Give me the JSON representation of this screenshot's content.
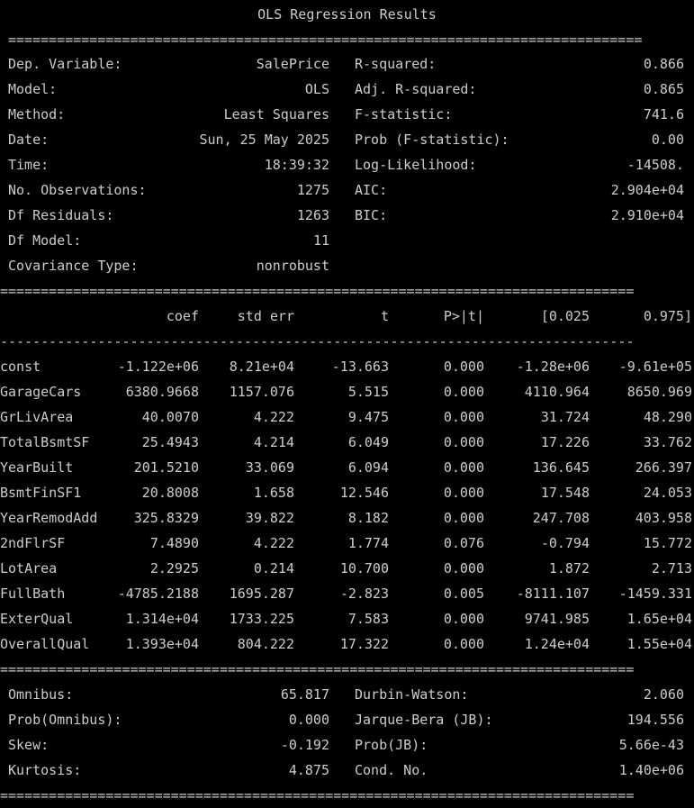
{
  "title": "OLS Regression Results",
  "rule_double": "==============================================================================",
  "rule_single": "------------------------------------------------------------------------------",
  "top_stats": [
    {
      "l_label": "Dep. Variable:",
      "l_value": "SalePrice",
      "r_label": "R-squared:",
      "r_value": "0.866"
    },
    {
      "l_label": "Model:",
      "l_value": "OLS",
      "r_label": "Adj. R-squared:",
      "r_value": "0.865"
    },
    {
      "l_label": "Method:",
      "l_value": "Least Squares",
      "r_label": "F-statistic:",
      "r_value": "741.6"
    },
    {
      "l_label": "Date:",
      "l_value": "Sun, 25 May 2025",
      "r_label": "Prob (F-statistic):",
      "r_value": "0.00"
    },
    {
      "l_label": "Time:",
      "l_value": "18:39:32",
      "r_label": "Log-Likelihood:",
      "r_value": "-14508."
    },
    {
      "l_label": "No. Observations:",
      "l_value": "1275",
      "r_label": "AIC:",
      "r_value": "2.904e+04"
    },
    {
      "l_label": "Df Residuals:",
      "l_value": "1263",
      "r_label": "BIC:",
      "r_value": "2.910e+04"
    },
    {
      "l_label": "Df Model:",
      "l_value": "11",
      "r_label": "",
      "r_value": ""
    },
    {
      "l_label": "Covariance Type:",
      "l_value": "nonrobust",
      "r_label": "",
      "r_value": ""
    }
  ],
  "coef_headers": [
    "coef",
    "std err",
    "t",
    "P>|t|",
    "[0.025",
    "0.975]"
  ],
  "coef_rows": [
    [
      "const",
      "-1.122e+06",
      "8.21e+04",
      "-13.663",
      "0.000",
      "-1.28e+06",
      "-9.61e+05"
    ],
    [
      "GarageCars",
      "6380.9668",
      "1157.076",
      "5.515",
      "0.000",
      "4110.964",
      "8650.969"
    ],
    [
      "GrLivArea",
      "40.0070",
      "4.222",
      "9.475",
      "0.000",
      "31.724",
      "48.290"
    ],
    [
      "TotalBsmtSF",
      "25.4943",
      "4.214",
      "6.049",
      "0.000",
      "17.226",
      "33.762"
    ],
    [
      "YearBuilt",
      "201.5210",
      "33.069",
      "6.094",
      "0.000",
      "136.645",
      "266.397"
    ],
    [
      "BsmtFinSF1",
      "20.8008",
      "1.658",
      "12.546",
      "0.000",
      "17.548",
      "24.053"
    ],
    [
      "YearRemodAdd",
      "325.8329",
      "39.822",
      "8.182",
      "0.000",
      "247.708",
      "403.958"
    ],
    [
      "2ndFlrSF",
      "7.4890",
      "4.222",
      "1.774",
      "0.076",
      "-0.794",
      "15.772"
    ],
    [
      "LotArea",
      "2.2925",
      "0.214",
      "10.700",
      "0.000",
      "1.872",
      "2.713"
    ],
    [
      "FullBath",
      "-4785.2188",
      "1695.287",
      "-2.823",
      "0.005",
      "-8111.107",
      "-1459.331"
    ],
    [
      "ExterQual",
      "1.314e+04",
      "1733.225",
      "7.583",
      "0.000",
      "9741.985",
      "1.65e+04"
    ],
    [
      "OverallQual",
      "1.393e+04",
      "804.222",
      "17.322",
      "0.000",
      "1.24e+04",
      "1.55e+04"
    ]
  ],
  "bottom_stats": [
    {
      "l_label": "Omnibus:",
      "l_value": "65.817",
      "r_label": "Durbin-Watson:",
      "r_value": "2.060"
    },
    {
      "l_label": "Prob(Omnibus):",
      "l_value": "0.000",
      "r_label": "Jarque-Bera (JB):",
      "r_value": "194.556"
    },
    {
      "l_label": "Skew:",
      "l_value": "-0.192",
      "r_label": "Prob(JB):",
      "r_value": "5.66e-43"
    },
    {
      "l_label": "Kurtosis:",
      "l_value": "4.875",
      "r_label": "Cond. No.",
      "r_value": "1.40e+06"
    }
  ]
}
